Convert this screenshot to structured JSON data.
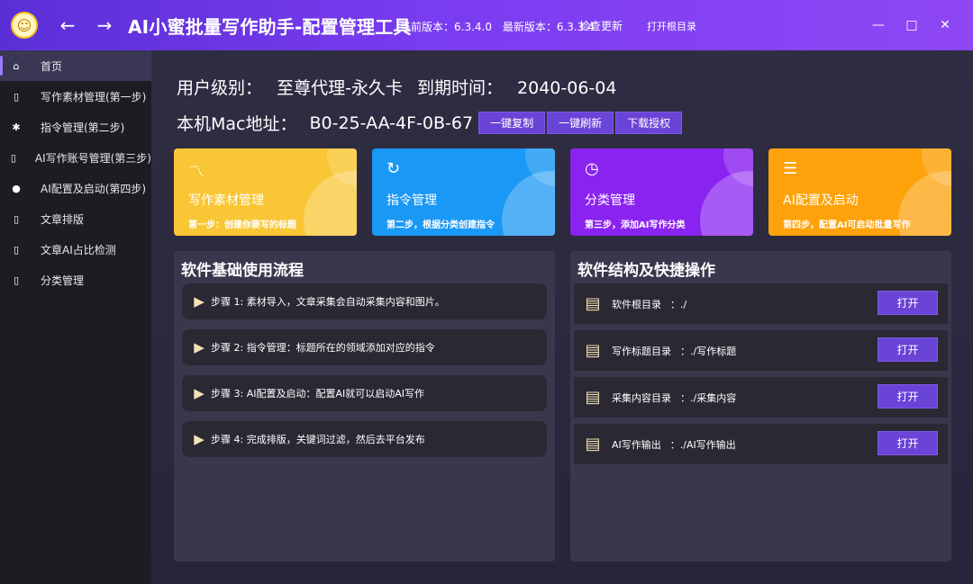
{
  "window": {
    "title": "AI小蜜批量写作助手-配置管理工具",
    "current_version_label": "当前版本：",
    "current_version": "6.3.4.0",
    "latest_version_label": "最新版本：",
    "latest_version": "6.3.3.4",
    "check_update": "检查更新",
    "open_root": "打开根目录"
  },
  "sidebar": {
    "items": [
      {
        "label": "首页",
        "icon": "home-icon"
      },
      {
        "label": "写作素材管理(第一步)",
        "icon": "document-icon"
      },
      {
        "label": "指令管理(第二步)",
        "icon": "gear-icon"
      },
      {
        "label": "AI写作账号管理(第三步)",
        "icon": "document-icon"
      },
      {
        "label": "AI配置及启动(第四步)",
        "icon": "bitcoin-icon"
      },
      {
        "label": "文章排版",
        "icon": "document-icon"
      },
      {
        "label": "文章AI占比检测",
        "icon": "document-icon"
      },
      {
        "label": "分类管理",
        "icon": "document-icon"
      }
    ]
  },
  "user": {
    "level_label": "用户级别：",
    "level_value": "至尊代理-永久卡",
    "expire_label": "到期时间：",
    "expire_value": "2040-06-04",
    "mac_label": "本机Mac地址：",
    "mac_value": "B0-25-AA-4F-0B-67",
    "copy_button": "一键复制",
    "refresh_button": "一键刷新",
    "download_button": "下载授权"
  },
  "cards": [
    {
      "title": "写作素材管理",
      "subtitle": "第一步：创建你要写的标题",
      "color": "#f9c635",
      "icon": "trend-icon"
    },
    {
      "title": "指令管理",
      "subtitle": "第二步，根据分类创建指令",
      "color": "#1a98f5",
      "icon": "history-icon"
    },
    {
      "title": "分类管理",
      "subtitle": "第三步，添加AI写作分类",
      "color": "#8b23f0",
      "icon": "clock-check-icon"
    },
    {
      "title": "AI配置及启动",
      "subtitle": "第四步，配置AI可启动批量写作",
      "color": "#fda20a",
      "icon": "list-star-icon"
    }
  ],
  "workflow": {
    "title": "软件基础使用流程",
    "steps": [
      "步骤 1: 素材导入，文章采集会自动采集内容和图片。",
      "步骤 2: 指令管理：标题所在的领域添加对应的指令",
      "步骤 3: AI配置及启动：配置AI就可以启动AI写作",
      "步骤 4: 完成排版，关键词过滤，然后去平台发布"
    ]
  },
  "structure": {
    "title": "软件结构及快捷操作",
    "open_label": "打开",
    "rows": [
      {
        "name": "软件根目录",
        "path": "：./"
      },
      {
        "name": "写作标题目录",
        "path": "：./写作标题"
      },
      {
        "name": "采集内容目录",
        "path": "：./采集内容"
      },
      {
        "name": "AI写作输出",
        "path": "：./AI写作输出"
      }
    ]
  }
}
